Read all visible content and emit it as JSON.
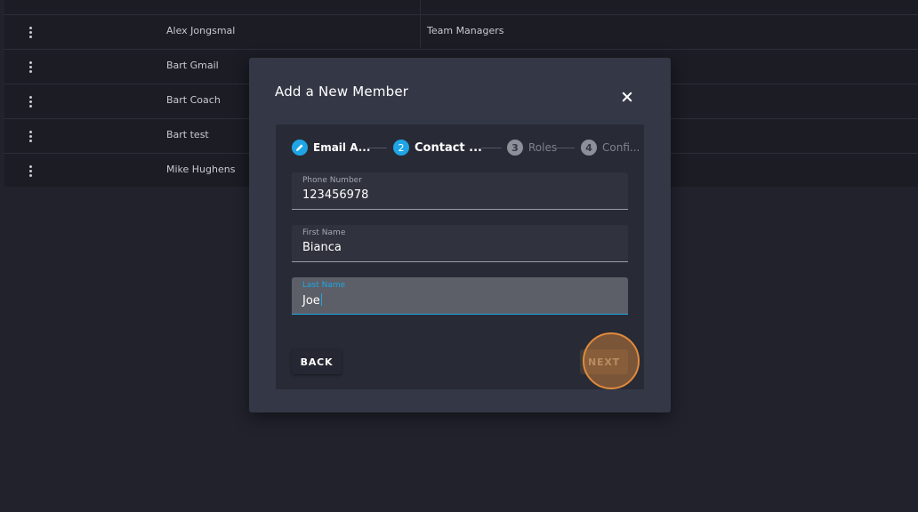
{
  "members_table": {
    "rows": [
      {
        "name": "Alex Jongsmal",
        "group": "Team Managers"
      },
      {
        "name": "Bart Gmail",
        "group": ""
      },
      {
        "name": "Bart Coach",
        "group": ""
      },
      {
        "name": "Bart test",
        "group": ""
      },
      {
        "name": "Mike Hughens",
        "group": ""
      }
    ]
  },
  "modal": {
    "title": "Add a New Member",
    "stepper": {
      "steps": [
        {
          "number": "1",
          "label": "Email A...",
          "state": "completed",
          "icon": "pencil-icon"
        },
        {
          "number": "2",
          "label": "Contact ...",
          "state": "active"
        },
        {
          "number": "3",
          "label": "Roles",
          "state": "inactive"
        },
        {
          "number": "4",
          "label": "Confi...",
          "state": "inactive"
        }
      ]
    },
    "fields": {
      "phone": {
        "label": "Phone Number",
        "value": "123456978"
      },
      "first_name": {
        "label": "First Name",
        "value": "Bianca"
      },
      "last_name": {
        "label": "Last Name",
        "value": "Joe"
      }
    },
    "buttons": {
      "back": "BACK",
      "next": "NEXT"
    }
  },
  "colors": {
    "accent": "#1fa5e6",
    "click_highlight": "#e08a3c"
  }
}
